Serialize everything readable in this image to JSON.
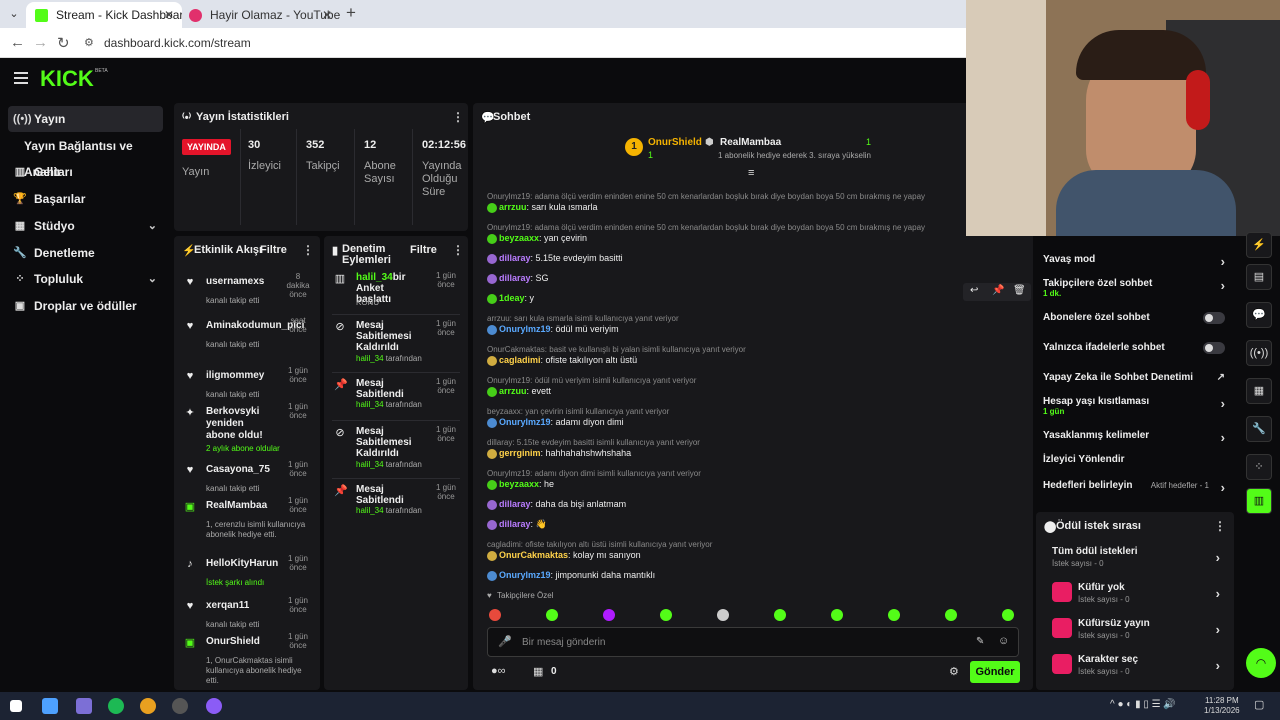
{
  "browser": {
    "tab1": "Stream - Kick Dashboard",
    "tab2": "Hayir Olamaz - YouTube M",
    "url": "dashboard.kick.com/stream"
  },
  "logo": {
    "text": "KICK",
    "beta": "BETA"
  },
  "sidebar": [
    {
      "label": "Yayın",
      "icon": "broadcast-icon",
      "active": true
    },
    {
      "label": "Yayın Bağlantısı ve Anahtarı",
      "icon": ""
    },
    {
      "label": "Gelir",
      "icon": "chart-icon"
    },
    {
      "label": "Başarılar",
      "icon": "trophy-icon"
    },
    {
      "label": "Stüdyo",
      "icon": "grid-icon",
      "chevron": true
    },
    {
      "label": "Denetleme",
      "icon": "wrench-icon"
    },
    {
      "label": "Topluluk",
      "icon": "community-icon",
      "chevron": true
    },
    {
      "label": "Droplar ve ödüller",
      "icon": "gift-icon"
    }
  ],
  "stats": {
    "title": "Yayın İstatistikleri",
    "live": "YAYINDA",
    "items": [
      {
        "label": "Yayın",
        "value": ""
      },
      {
        "label": "İzleyici",
        "value": "30"
      },
      {
        "label": "Takipçi",
        "value": "352"
      },
      {
        "label": "Abone Sayısı",
        "value": "12"
      },
      {
        "label": "Yayında Olduğu Süre",
        "value": "02:12:56"
      }
    ]
  },
  "activity": {
    "title": "Etkinlik Akışı",
    "filter": "Filtre",
    "items": [
      {
        "name": "usernamexs",
        "time": "8 dakika önce",
        "sub": "kanalı takip etti"
      },
      {
        "name": "Aminakodumun_pici",
        "time": "saat önce",
        "sub": "kanalı takip etti"
      },
      {
        "name": "iligmommey",
        "time": "1 gün önce",
        "sub": "kanalı takip etti"
      },
      {
        "name": "Berkovsyki yeniden abone oldu!",
        "time": "1 gün önce",
        "sub": "2 aylık abone oldular"
      },
      {
        "name": "Casayona_75",
        "time": "1 gün önce",
        "sub": "kanalı takip etti"
      },
      {
        "name": "RealMambaa",
        "time": "1 gün önce",
        "sub": "1, cerenzlu isimli kullanıcıya abonelik hediye etti."
      },
      {
        "name": "HelloKityHarun",
        "time": "1 gün önce",
        "sub": "İstek şarkı alındı"
      },
      {
        "name": "xerqan11",
        "time": "1 gün önce",
        "sub": "kanalı takip etti"
      },
      {
        "name": "OnurShield",
        "time": "1 gün önce",
        "sub": "1, OnurCakmaktas isimli kullanıcıya abonelik hediye etti."
      }
    ]
  },
  "modactions": {
    "title": "Denetim Eylemleri",
    "filter": "Filtre",
    "items": [
      {
        "name": "halil_34",
        "action": "bir Anket başlattı",
        "time": "1 gün önce",
        "sub": "KONU"
      },
      {
        "name": "Mesaj Sabitlemesi Kaldırıldı",
        "time": "1 gün önce",
        "sub": "halil_34 tarafından"
      },
      {
        "name": "Mesaj Sabitlendi",
        "time": "1 gün önce",
        "sub": "halil_34 tarafından"
      },
      {
        "name": "Mesaj Sabitlemesi Kaldırıldı",
        "time": "1 gün önce",
        "sub": "halil_34 tarafından"
      },
      {
        "name": "Mesaj Sabitlendi",
        "time": "1 gün önce",
        "sub": "halil_34 tarafından"
      }
    ]
  },
  "chat": {
    "title": "Sohbet",
    "top1": "OnurShield",
    "top1count": "1",
    "top2": "RealMambaa",
    "top2count": "1",
    "top2note": "1 abonelik hediye ederek 3. sıraya yükselin",
    "lines": [
      {
        "reply": "Onurylmz19: adama ölçü verdim eninden enine 50 cm kenarlardan boşluk bırak diye boydan boya 50 cm bırakmış ne yapay",
        "user": "arrzuu",
        "color": "#53fc18",
        "msg": "sarı kula ısmarla"
      },
      {
        "reply": "Onurylmz19: adama ölçü verdim eninden enine 50 cm kenarlardan boşluk bırak diye boydan boya 50 cm bırakmış ne yapay",
        "user": "beyzaaxx",
        "color": "#53fc18",
        "msg": "yan çevirin"
      },
      {
        "reply": "",
        "user": "dillaray",
        "color": "#b97cff",
        "msg": "5.15te evdeyim basitti"
      },
      {
        "reply": "",
        "user": "dillaray",
        "color": "#b97cff",
        "msg": "SG"
      },
      {
        "reply": "",
        "user": "1deay",
        "color": "#53fc18",
        "msg": "y"
      },
      {
        "reply": "arrzuu: sarı kula ısmarla isimli kullanıcıya yanıt veriyor",
        "user": "Onurylmz19",
        "color": "#5aa9ff",
        "msg": "ödül mü veriyim"
      },
      {
        "reply": "OnurCakmaktas: basit ve kullanışlı bi yalan isimli kullanıcıya yanıt veriyor",
        "user": "cagladimi",
        "color": "#ffd24a",
        "msg": "ofiste takılıyon altı üstü"
      },
      {
        "reply": "Onurylmz19: ödül mü veriyim isimli kullanıcıya yanıt veriyor",
        "user": "arrzuu",
        "color": "#53fc18",
        "msg": "evett"
      },
      {
        "reply": "beyzaaxx: yan çevirin isimli kullanıcıya yanıt veriyor",
        "user": "Onurylmz19",
        "color": "#5aa9ff",
        "msg": "adamı diyon dimi"
      },
      {
        "reply": "dillaray: 5.15te evdeyim basitti isimli kullanıcıya yanıt veriyor",
        "user": "gerrginim",
        "color": "#ffd24a",
        "msg": "hahhahahshwhshaha"
      },
      {
        "reply": "Onurylmz19: adamı diyon dimi isimli kullanıcıya yanıt veriyor",
        "user": "beyzaaxx",
        "color": "#53fc18",
        "msg": "he"
      },
      {
        "reply": "",
        "user": "dillaray",
        "color": "#b97cff",
        "msg": "daha da bişi anlatmam"
      },
      {
        "reply": "",
        "user": "dillaray",
        "color": "#b97cff",
        "msg": "👋"
      },
      {
        "reply": "cagladimi: ofiste takılıyon altı üstü isimli kullanıcıya yanıt veriyor",
        "user": "OnurCakmaktas",
        "color": "#ffd24a",
        "msg": "kolay mı sanıyon"
      },
      {
        "reply": "",
        "user": "Onurylmz19",
        "color": "#5aa9ff",
        "msg": "jimponunki daha mantıklı"
      }
    ],
    "followers_only": "Takipçilere Özel",
    "input_placeholder": "Bir mesaj gönderin",
    "send": "Gönder",
    "points": "0"
  },
  "settings": [
    {
      "label": "Yavaş mod",
      "type": "arrow",
      "sub": ""
    },
    {
      "label": "Takipçilere özel sohbet",
      "type": "arrow",
      "sub": "1 dk."
    },
    {
      "label": "Abonelere özel sohbet",
      "type": "toggle",
      "sub": ""
    },
    {
      "label": "Yalnızca ifadelerle sohbet",
      "type": "toggle",
      "sub": ""
    },
    {
      "label": "Yapay Zeka ile Sohbet Denetimi",
      "type": "link",
      "sub": ""
    },
    {
      "label": "Hesap yaşı kısıtlaması",
      "type": "arrow",
      "sub": "1 gün"
    },
    {
      "label": "Yasaklanmış kelimeler",
      "type": "arrow",
      "sub": ""
    },
    {
      "label": "İzleyici Yönlendir",
      "type": "none",
      "sub": ""
    },
    {
      "label": "Hedefleri belirleyin",
      "type": "arrow",
      "sub": "",
      "extra": "Aktif hedefler - 1"
    }
  ],
  "rewards": {
    "title": "Ödül istek sırası",
    "items": [
      {
        "label": "Tüm ödül istekleri",
        "sub": "İstek sayısı - 0",
        "icon": ""
      },
      {
        "label": "Küfür yok",
        "sub": "İstek sayısı - 0",
        "icon": "reward-icon"
      },
      {
        "label": "Küfürsüz yayın",
        "sub": "İstek sayısı - 0",
        "icon": "reward-icon"
      },
      {
        "label": "Karakter seç",
        "sub": "İstek sayısı - 0",
        "icon": "reward-icon"
      }
    ]
  },
  "taskbar": {
    "time": "11:28 PM",
    "date": "1/13/2026"
  }
}
